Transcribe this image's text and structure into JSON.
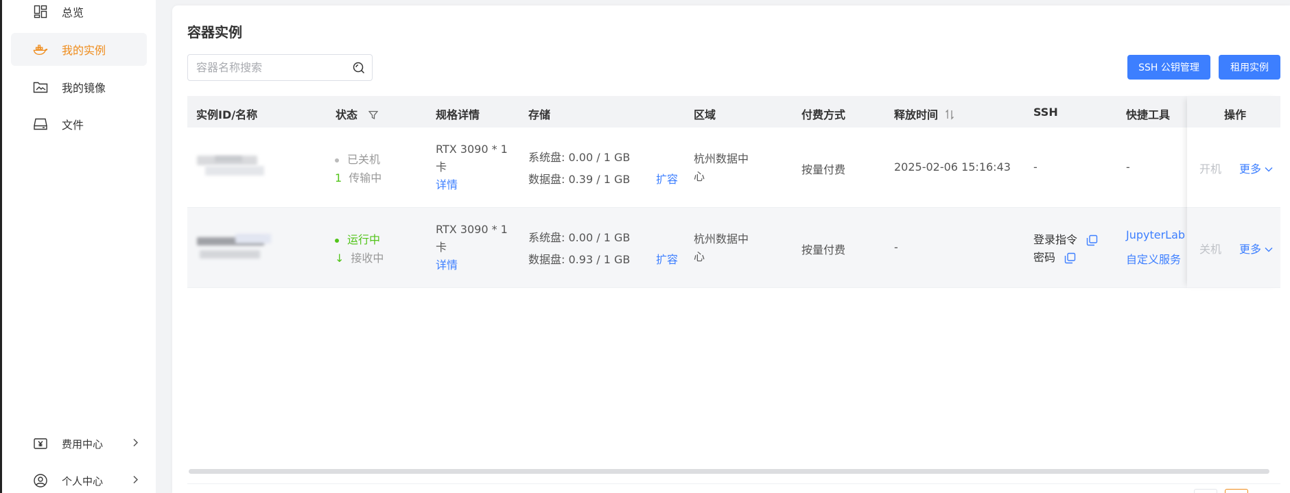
{
  "sidebar": {
    "items": [
      {
        "label": "总览",
        "icon": "dashboard-icon"
      },
      {
        "label": "我的实例",
        "icon": "docker-whale-icon",
        "active": true
      },
      {
        "label": "我的镜像",
        "icon": "image-folder-icon"
      },
      {
        "label": "文件",
        "icon": "drive-icon"
      }
    ],
    "bottom_items": [
      {
        "label": "费用中心",
        "icon": "yen-icon"
      },
      {
        "label": "个人中心",
        "icon": "user-circle-icon"
      }
    ]
  },
  "page": {
    "title": "容器实例",
    "search_placeholder": "容器名称搜索",
    "ssh_button": "SSH 公钥管理",
    "rent_button": "租用实例"
  },
  "table": {
    "headers": {
      "id": "实例ID/名称",
      "status": "状态",
      "spec": "规格详情",
      "storage": "存储",
      "region": "区域",
      "billing": "付费方式",
      "release": "释放时间",
      "ssh": "SSH",
      "tools": "快捷工具",
      "ops": "操作"
    },
    "rows": [
      {
        "status": "已关机",
        "transfer": "传输中",
        "transfer_glyph": "1",
        "spec_line1": "RTX 3090 * 1",
        "spec_line2": "卡",
        "detail": "详情",
        "sys_disk_label": "系统盘:",
        "sys_disk": "0.00",
        "sys_total": "/  1 GB",
        "data_disk_label": "数据盘:",
        "data_disk": "0.39",
        "data_total": "/  1 GB",
        "expand": "扩容",
        "region_line1": "杭州数据中",
        "region_line2": "心",
        "billing": "按量付费",
        "release": "2025-02-06 15:16:43",
        "ssh": "-",
        "tools": "-",
        "power": "开机",
        "more": "更多"
      },
      {
        "status": "运行中",
        "transfer": "接收中",
        "transfer_glyph": "↓",
        "spec_line1": "RTX 3090 * 1",
        "spec_line2": "卡",
        "detail": "详情",
        "sys_disk_label": "系统盘:",
        "sys_disk": "0.00",
        "sys_total": "/  1 GB",
        "data_disk_label": "数据盘:",
        "data_disk": "0.93",
        "data_total": "/  1 GB",
        "expand": "扩容",
        "region_line1": "杭州数据中",
        "region_line2": "心",
        "billing": "按量付费",
        "release": "-",
        "ssh_login": "登录指令",
        "ssh_password": "密码",
        "tool_jupyter": "JupyterLab",
        "tool_custom": "自定义服务",
        "power": "关机",
        "more": "更多"
      }
    ]
  },
  "colors": {
    "accent": "#3d7fff",
    "active_nav": "#ef8b1a",
    "running": "#52c41a"
  }
}
